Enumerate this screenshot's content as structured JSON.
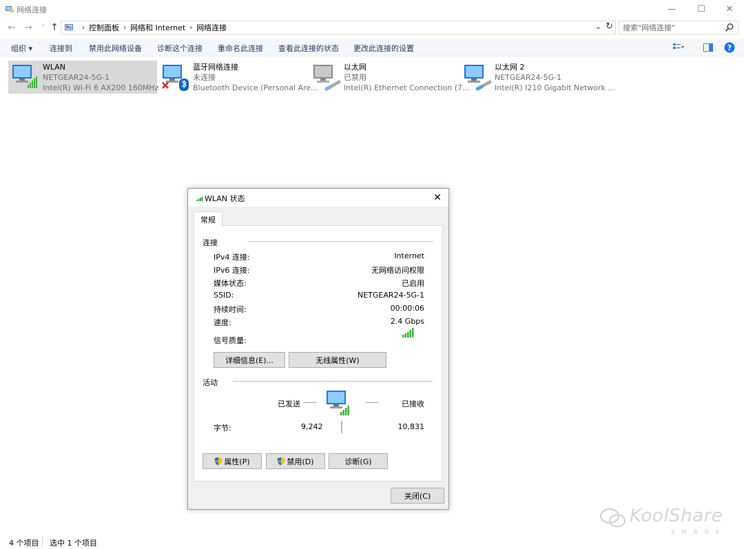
{
  "window": {
    "title": "网络连接",
    "minimize_glyph": "—",
    "maximize_glyph": "☐",
    "close_glyph": "✕"
  },
  "nav": {
    "back_glyph": "←",
    "forward_glyph": "→",
    "recent_glyph": "˅",
    "up_glyph": "↑"
  },
  "breadcrumb": {
    "items": [
      "控制面板",
      "网络和 Internet",
      "网络连接"
    ],
    "sep": "›"
  },
  "search": {
    "placeholder": "搜索\"网络连接\""
  },
  "toolbar": {
    "organize": "组织 ▾",
    "connect_to": "连接到",
    "disable_device": "禁用此网络设备",
    "diagnose": "诊断这个连接",
    "rename": "重命名此连接",
    "view_status": "查看此连接的状态",
    "change_settings": "更改此连接的设置"
  },
  "adapters": [
    {
      "name": "WLAN",
      "line1": "NETGEAR24-5G-1",
      "line2": "Intel(R) Wi-Fi 6 AX200 160MHz",
      "icon": "wifi-adapter-icon",
      "selected": true
    },
    {
      "name": "蓝牙网络连接",
      "line1": "未连接",
      "line2": "Bluetooth Device (Personal Are...",
      "icon": "bluetooth-adapter-icon"
    },
    {
      "name": "以太网",
      "line1": "已禁用",
      "line2": "Intel(R) Ethernet Connection (7...",
      "icon": "ethernet-adapter-icon"
    },
    {
      "name": "以太网 2",
      "line1": "NETGEAR24-5G-1",
      "line2": "Intel(R) I210 Gigabit Network ...",
      "icon": "ethernet-adapter-icon"
    }
  ],
  "statusbar": {
    "items_count": "4 个项目",
    "selected_count": "选中 1 个项目"
  },
  "dialog": {
    "title": "WLAN 状态",
    "tab": "常规",
    "connection_section": "连接",
    "rows": [
      {
        "label": "IPv4 连接:",
        "value": "Internet"
      },
      {
        "label": "IPv6 连接:",
        "value": "无网络访问权限"
      },
      {
        "label": "媒体状态:",
        "value": "已启用"
      },
      {
        "label": "SSID:",
        "value": "NETGEAR24-5G-1"
      },
      {
        "label": "持续时间:",
        "value": "00:00:06"
      },
      {
        "label": "速度:",
        "value": "2.4 Gbps"
      }
    ],
    "signal_label": "信号质量:",
    "signal_bars": 5,
    "details_button": "详细信息(E)...",
    "wireless_props_button": "无线属性(W)",
    "activity_section": "活动",
    "sent_label": "已发送",
    "received_label": "已接收",
    "bytes_label": "字节:",
    "bytes_sent": "9,242",
    "bytes_received": "10,831",
    "properties_button": "属性(P)",
    "disable_button": "禁用(D)",
    "diagnose_button": "诊断(G)",
    "close_button": "关闭(C)"
  },
  "watermark": {
    "text": "KoolShare",
    "sub": "SHARE"
  },
  "colors": {
    "toolbar_bg": "#f5f7fb",
    "toolbar_text": "#1e395b",
    "selected_bg": "#cce8ff",
    "signal_green": "#3cb043",
    "help_blue": "#1a73e8"
  }
}
